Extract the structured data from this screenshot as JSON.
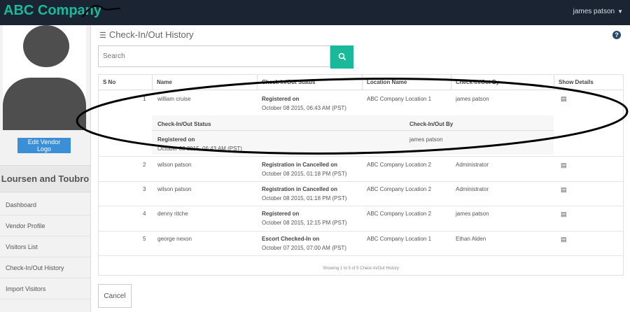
{
  "app": {
    "brand": "ABC Company",
    "user_name": "james patson"
  },
  "sidebar": {
    "edit_logo_label": "Edit Vendor Logo",
    "vendor_name": "Loursen and Toubro",
    "nav": [
      "Dashboard",
      "Vendor Profile",
      "Visitors List",
      "Check-In/Out History",
      "Import Visitors"
    ]
  },
  "main": {
    "title": "Check-In/Out History",
    "search": {
      "placeholder": "Search",
      "value": ""
    },
    "table": {
      "headers": [
        "S No",
        "Name",
        "Check-In/Out Status",
        "Location Name",
        "Check-In/Out By",
        "Show Details"
      ],
      "rows": [
        {
          "sno": "1",
          "name": "william cruise",
          "status": "Registered on",
          "date": "October 08 2015, 06:43 AM (PST)",
          "location": "ABC Company Location 1",
          "by": "james patson"
        },
        {
          "sno": "2",
          "name": "wilson patson",
          "status": "Registration in Cancelled on",
          "date": "October 08 2015, 01:18 PM (PST)",
          "location": "ABC Company Location 2",
          "by": "Administrator"
        },
        {
          "sno": "3",
          "name": "wilson patson",
          "status": "Registration in Cancelled on",
          "date": "October 08 2015, 01:18 PM (PST)",
          "location": "ABC Company Location 2",
          "by": "Administrator"
        },
        {
          "sno": "4",
          "name": "denny ritche",
          "status": "Registered on",
          "date": "October 08 2015, 12:15 PM (PST)",
          "location": "ABC Company Location 2",
          "by": "james patson"
        },
        {
          "sno": "5",
          "name": "george nexon",
          "status": "Escort Checked-In on",
          "date": "October 07 2015, 07:00 AM (PST)",
          "location": "ABC Company Location 1",
          "by": "Ethan Alden"
        }
      ],
      "detail": {
        "headers": [
          "Check-In/Out Status",
          "Check-In/Out By"
        ],
        "status": "Registered on",
        "date": "October 08 2015, 06:43 AM (PST)",
        "by": "james patson"
      },
      "footer": "Showing 1 to 5 of 5 Check-In/Out History"
    },
    "cancel_label": "Cancel"
  },
  "icons": {
    "help": "help-icon",
    "search": "search-icon",
    "list": "list-icon",
    "details": "details-icon"
  }
}
